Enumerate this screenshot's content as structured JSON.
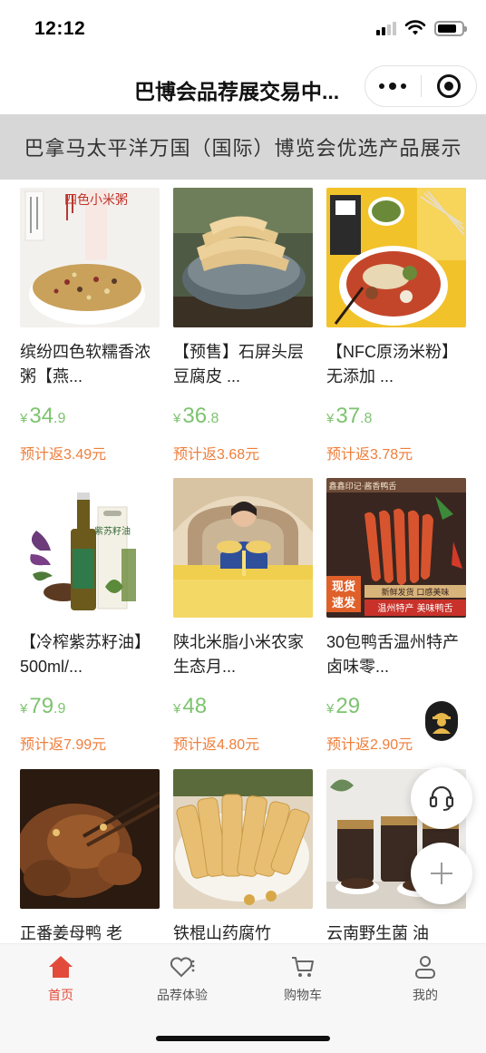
{
  "status_bar": {
    "time": "12:12"
  },
  "nav": {
    "title": "巴博会品荐展交易中..."
  },
  "banner": {
    "text": "巴拿马太平洋万国（国际）博览会优选产品展示"
  },
  "currency_symbol": "¥",
  "products": [
    {
      "name": "缤纷四色软糯香浓粥【燕...",
      "price_int": "34",
      "price_dec": ".9",
      "rebate": "预计返3.49元",
      "image": "four-color-millet-porridge-image",
      "image_text": "四色小米粥"
    },
    {
      "name": "【预售】石屏头层豆腐皮 ...",
      "price_int": "36",
      "price_dec": ".8",
      "rebate": "预计返3.68元",
      "image": "tofu-skin-image"
    },
    {
      "name": "【NFC原汤米粉】无添加 ...",
      "price_int": "37",
      "price_dec": ".8",
      "rebate": "预计返3.78元",
      "image": "rice-noodle-image"
    },
    {
      "name": "【冷榨紫苏籽油】 500ml/...",
      "price_int": "79",
      "price_dec": ".9",
      "rebate": "预计返7.99元",
      "image": "perilla-oil-image",
      "image_text": "紫苏籽油"
    },
    {
      "name": "陕北米脂小米农家生态月...",
      "price_int": "48",
      "price_dec": "",
      "rebate": "预计返4.80元",
      "image": "millet-farmer-image"
    },
    {
      "name": "30包鸭舌温州特产卤味零...",
      "price_int": "29",
      "price_dec": "",
      "rebate": "预计返2.90元",
      "image": "duck-tongue-image",
      "image_text": "鑫鑫印记·酱香鸭舌",
      "badge_1": "现货",
      "badge_2": "速发",
      "tag_1": "新鲜发货 口感美味",
      "tag_2": "温州特产 美味鸭舌"
    },
    {
      "name": "正番姜母鸭 老",
      "price_int": "",
      "price_dec": "",
      "rebate": "",
      "image": "ginger-duck-image"
    },
    {
      "name": "铁棍山药腐竹",
      "price_int": "",
      "price_dec": "",
      "rebate": "",
      "image": "yam-yuba-image"
    },
    {
      "name": "云南野生菌 油",
      "price_int": "",
      "price_dec": "",
      "rebate": "",
      "image": "wild-mushroom-image"
    }
  ],
  "tabs": [
    {
      "label": "首页",
      "icon": "home-icon",
      "active": true
    },
    {
      "label": "品荐体验",
      "icon": "heart-icon",
      "active": false
    },
    {
      "label": "购物车",
      "icon": "cart-icon",
      "active": false
    },
    {
      "label": "我的",
      "icon": "profile-icon",
      "active": false
    }
  ],
  "colors": {
    "price": "#7dc36f",
    "rebate": "#ef7e3b",
    "tab_active": "#e24b3b",
    "banner_bg": "#d7d7d7"
  }
}
